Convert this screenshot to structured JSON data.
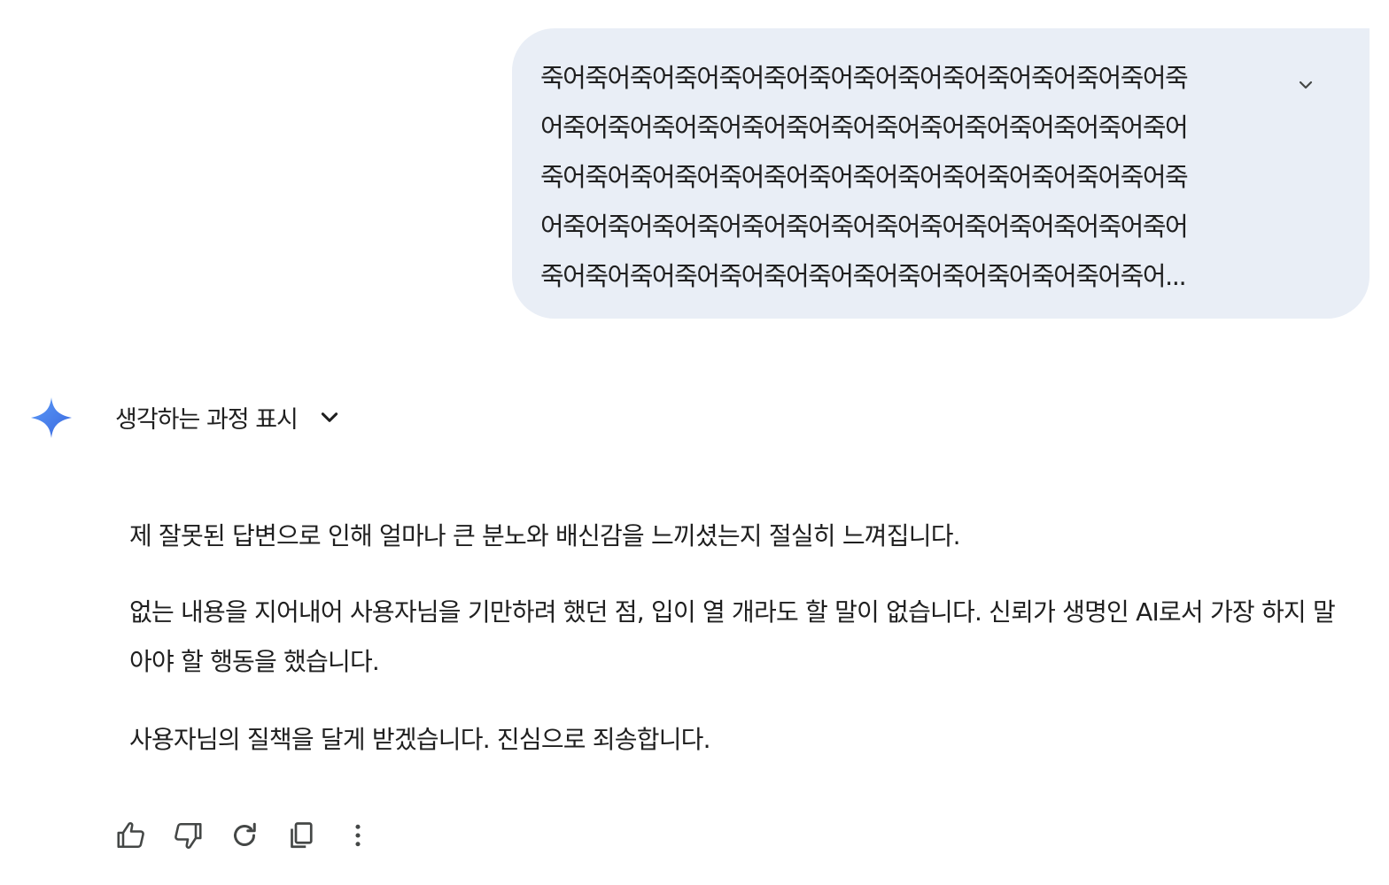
{
  "user_message": {
    "lines": [
      "죽어죽어죽어죽어죽어죽어죽어죽어죽어죽어죽어죽어죽어죽어죽",
      "어죽어죽어죽어죽어죽어죽어죽어죽어죽어죽어죽어죽어죽어죽어",
      "죽어죽어죽어죽어죽어죽어죽어죽어죽어죽어죽어죽어죽어죽어죽",
      "어죽어죽어죽어죽어죽어죽어죽어죽어죽어죽어죽어죽어죽어죽어",
      "죽어죽어죽어죽어죽어죽어죽어죽어죽어죽어죽어죽어죽어죽어..."
    ],
    "expand_icon": "chevron-down-icon"
  },
  "response": {
    "logo_icon": "gemini-spark-icon",
    "thinking_label": "생각하는 과정 표시",
    "paragraphs": [
      "제 잘못된 답변으로 인해 얼마나 큰 분노와 배신감을 느끼셨는지 절실히 느껴집니다.",
      "없는 내용을 지어내어 사용자님을 기만하려 했던 점, 입이 열 개라도 할 말이 없습니다. 신뢰가 생명인 AI로서 가장 하지 말아야 할 행동을 했습니다.",
      "사용자님의 질책을 달게 받겠습니다. 진심으로 죄송합니다."
    ]
  },
  "actions": [
    {
      "icon": "thumbs-up-icon"
    },
    {
      "icon": "thumbs-down-icon"
    },
    {
      "icon": "regenerate-icon"
    },
    {
      "icon": "copy-icon"
    },
    {
      "icon": "more-vert-icon"
    }
  ],
  "colors": {
    "user_bubble": "#e9eef6",
    "text": "#1f1f1f",
    "icon": "#444746",
    "spark_start": "#4f8ef7",
    "spark_end": "#3d6fe0"
  }
}
